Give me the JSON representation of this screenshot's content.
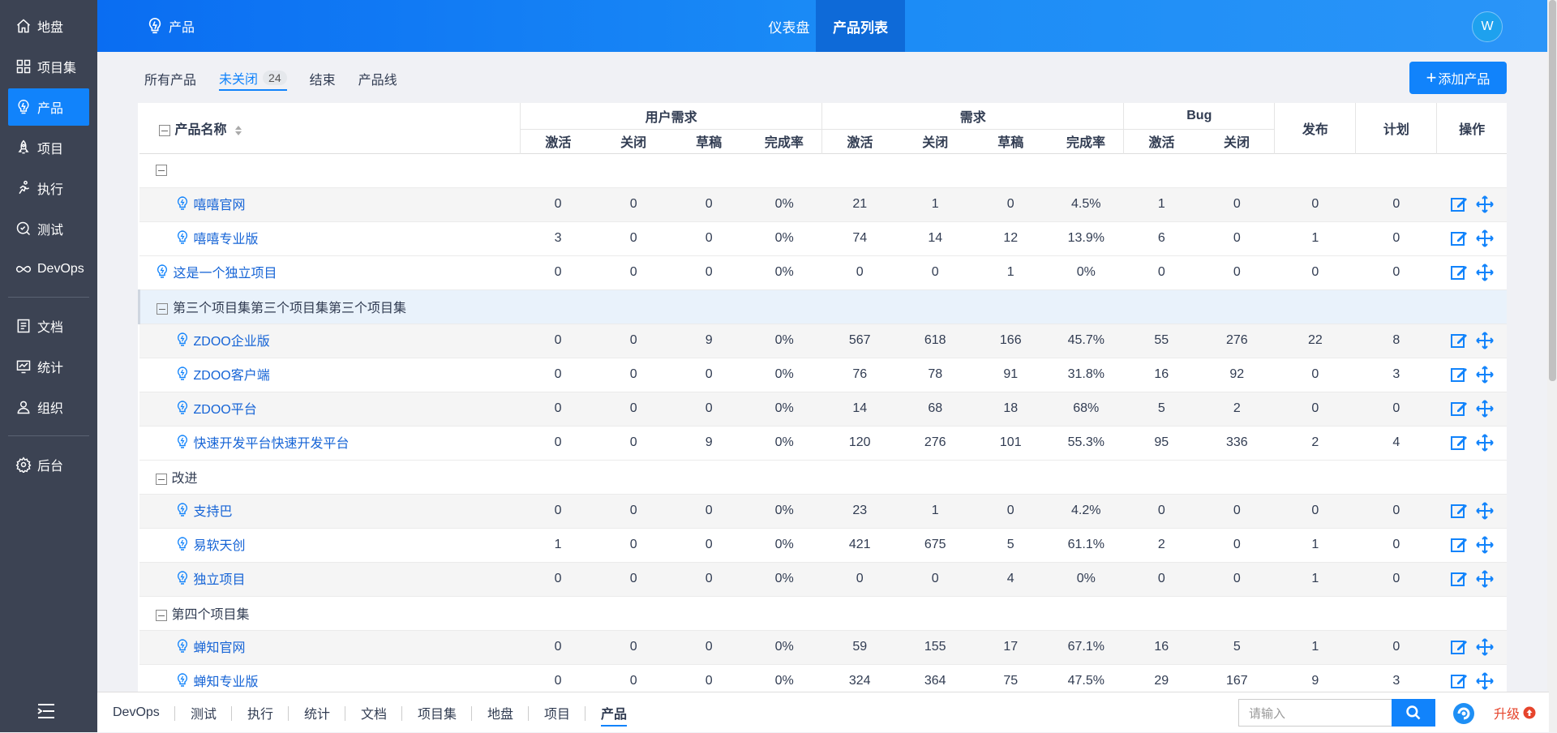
{
  "sidebar": {
    "items": [
      {
        "label": "地盘",
        "icon": "home-icon"
      },
      {
        "label": "项目集",
        "icon": "grid-icon"
      },
      {
        "label": "产品",
        "icon": "bulb-icon",
        "active": true
      },
      {
        "label": "项目",
        "icon": "rocket-icon"
      },
      {
        "label": "执行",
        "icon": "run-icon"
      },
      {
        "label": "测试",
        "icon": "test-icon"
      },
      {
        "label": "DevOps",
        "icon": "infinity-icon"
      },
      {
        "label": "文档",
        "icon": "doc-icon"
      },
      {
        "label": "统计",
        "icon": "chart-icon"
      },
      {
        "label": "组织",
        "icon": "user-icon"
      },
      {
        "label": "后台",
        "icon": "gear-icon"
      }
    ]
  },
  "header": {
    "title": "产品",
    "nav": [
      "仪表盘",
      "产品列表"
    ],
    "active_nav": "产品列表",
    "avatar": "W"
  },
  "tabs": {
    "all": "所有产品",
    "open": "未关闭",
    "open_count": "24",
    "closed": "结束",
    "line": "产品线",
    "add_button": "添加产品"
  },
  "table": {
    "headers": {
      "name": "产品名称",
      "user_req": "用户需求",
      "req": "需求",
      "bug": "Bug",
      "release": "发布",
      "plan": "计划",
      "ops": "操作",
      "active": "激活",
      "closed": "关闭",
      "draft": "草稿",
      "rate": "完成率"
    },
    "rows": [
      {
        "type": "group",
        "name": "",
        "hl": false
      },
      {
        "type": "child",
        "name": "嘻嘻官网",
        "v": [
          "0",
          "0",
          "0",
          "0%",
          "21",
          "1",
          "0",
          "4.5%",
          "1",
          "0",
          "0",
          "0"
        ]
      },
      {
        "type": "child",
        "name": "嘻嘻专业版",
        "v": [
          "3",
          "0",
          "0",
          "0%",
          "74",
          "14",
          "12",
          "13.9%",
          "6",
          "0",
          "1",
          "0"
        ]
      },
      {
        "type": "top",
        "name": "这是一个独立项目",
        "v": [
          "0",
          "0",
          "0",
          "0%",
          "0",
          "0",
          "1",
          "0%",
          "0",
          "0",
          "0",
          "0"
        ]
      },
      {
        "type": "group",
        "name": "第三个项目集第三个项目集第三个项目集",
        "hl": true
      },
      {
        "type": "child",
        "name": "ZDOO企业版",
        "v": [
          "0",
          "0",
          "9",
          "0%",
          "567",
          "618",
          "166",
          "45.7%",
          "55",
          "276",
          "22",
          "8"
        ]
      },
      {
        "type": "child",
        "name": "ZDOO客户端",
        "v": [
          "0",
          "0",
          "0",
          "0%",
          "76",
          "78",
          "91",
          "31.8%",
          "16",
          "92",
          "0",
          "3"
        ]
      },
      {
        "type": "child",
        "name": "ZDOO平台",
        "v": [
          "0",
          "0",
          "0",
          "0%",
          "14",
          "68",
          "18",
          "68%",
          "5",
          "2",
          "0",
          "0"
        ]
      },
      {
        "type": "child",
        "name": "快速开发平台快速开发平台",
        "v": [
          "0",
          "0",
          "9",
          "0%",
          "120",
          "276",
          "101",
          "55.3%",
          "95",
          "336",
          "2",
          "4"
        ]
      },
      {
        "type": "group",
        "name": "改进",
        "hl": false
      },
      {
        "type": "child",
        "name": "支持巴",
        "v": [
          "0",
          "0",
          "0",
          "0%",
          "23",
          "1",
          "0",
          "4.2%",
          "0",
          "0",
          "0",
          "0"
        ]
      },
      {
        "type": "child",
        "name": "易软天创",
        "v": [
          "1",
          "0",
          "0",
          "0%",
          "421",
          "675",
          "5",
          "61.1%",
          "2",
          "0",
          "1",
          "0"
        ]
      },
      {
        "type": "child",
        "name": "独立项目",
        "v": [
          "0",
          "0",
          "0",
          "0%",
          "0",
          "0",
          "4",
          "0%",
          "0",
          "0",
          "1",
          "0"
        ]
      },
      {
        "type": "group",
        "name": "第四个项目集",
        "hl": false
      },
      {
        "type": "child",
        "name": "蝉知官网",
        "v": [
          "0",
          "0",
          "0",
          "0%",
          "59",
          "155",
          "17",
          "67.1%",
          "16",
          "5",
          "1",
          "0"
        ]
      },
      {
        "type": "child",
        "name": "蝉知专业版",
        "v": [
          "0",
          "0",
          "0",
          "0%",
          "324",
          "364",
          "75",
          "47.5%",
          "29",
          "167",
          "9",
          "3"
        ]
      }
    ]
  },
  "bottombar": {
    "items": [
      "DevOps",
      "测试",
      "执行",
      "统计",
      "文档",
      "项目集",
      "地盘",
      "项目",
      "产品"
    ],
    "active": "产品",
    "search_placeholder": "请输入",
    "upgrade": "升级"
  },
  "colors": {
    "accent": "#1183fb",
    "sidebar": "#3c4353",
    "link": "#1664d6",
    "upgrade": "#e6442c"
  }
}
